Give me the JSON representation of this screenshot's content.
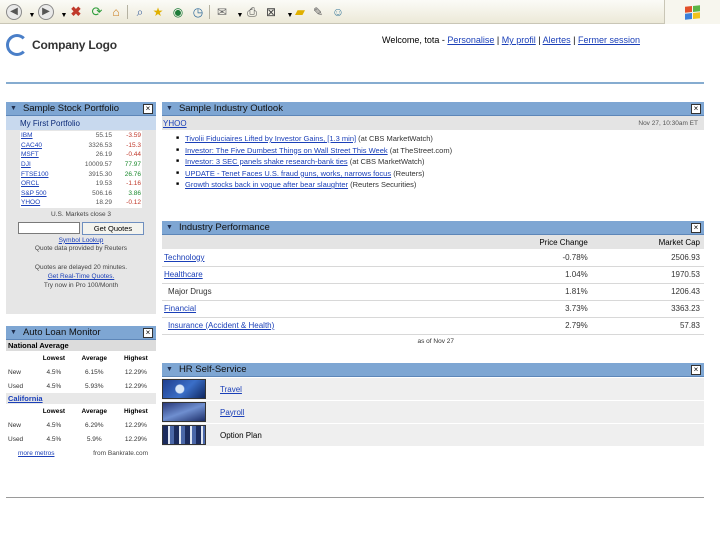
{
  "header": {
    "logo_text": "Company Logo",
    "welcome": "Welcome, tota -",
    "links": [
      "Personalise",
      "My profil",
      "Alertes",
      "Fermer session"
    ]
  },
  "stock_portfolio": {
    "title": "Sample Stock Portfolio",
    "subtitle": "My First Portfolio",
    "rows": [
      {
        "symbol": "IBM",
        "price": "55.15",
        "change": "-3.59",
        "dir": "neg"
      },
      {
        "symbol": "CAC40",
        "price": "3326.53",
        "change": "-15.3",
        "dir": "neg"
      },
      {
        "symbol": "MSFT",
        "price": "26.19",
        "change": "-0.44",
        "dir": "neg"
      },
      {
        "symbol": "DJI",
        "price": "10009.57",
        "change": "77.97",
        "dir": "pos"
      },
      {
        "symbol": "FTSE100",
        "price": "3915.30",
        "change": "26.76",
        "dir": "pos"
      },
      {
        "symbol": "ORCL",
        "price": "19.53",
        "change": "-1.16",
        "dir": "neg"
      },
      {
        "symbol": "S&P 500",
        "price": "506.16",
        "change": "3.86",
        "dir": "pos"
      },
      {
        "symbol": "YHOO",
        "price": "18.29",
        "change": "-0.12",
        "dir": "neg"
      }
    ],
    "market_note": "U.S. Markets close 3",
    "quote_button": "Get Quotes",
    "symbol_lookup": "Symbol Lookup",
    "quote_provider": "Quote data provided by Reuters",
    "delay_note": "Quotes are delayed 20 minutes.",
    "realtime_link": "Get Real-Time Quotes.",
    "pro_note": "Try now in Pro 100/Month"
  },
  "auto_loan": {
    "title": "Auto Loan Monitor",
    "columns": [
      "",
      "Lowest",
      "Average",
      "Highest"
    ],
    "regions": [
      {
        "name": "National Average",
        "rows": [
          [
            "New",
            "4.5%",
            "6.15%",
            "12.29%"
          ],
          [
            "Used",
            "4.5%",
            "5.93%",
            "12.29%"
          ]
        ]
      },
      {
        "name": "California",
        "rows": [
          [
            "New",
            "4.5%",
            "6.29%",
            "12.29%"
          ],
          [
            "Used",
            "4.5%",
            "5.9%",
            "12.29%"
          ]
        ]
      }
    ],
    "more_link": "more metros",
    "source": "from Bankrate.com"
  },
  "industry_outlook": {
    "title": "Sample Industry Outlook",
    "source": "YHOO",
    "date": "Nov 27, 10:30am ET",
    "news": [
      {
        "headline": "Tivolii Fiduciaires Lifted by Investor Gains, [1.3 min]",
        "source": "(at CBS MarketWatch)"
      },
      {
        "headline": "Investor: The Five Dumbest Things on Wall Street This Week",
        "source": "(at TheStreet.com)"
      },
      {
        "headline": "Investor: 3 SEC panels shake research-bank ties",
        "source": "(at CBS MarketWatch)"
      },
      {
        "headline": "UPDATE - Tenet Faces U.S. fraud guns, works, narrows focus",
        "source": "(Reuters)"
      },
      {
        "headline": "Growth stocks back in vogue after bear slaughter",
        "source": "(Reuters Securities)"
      }
    ]
  },
  "industry_performance": {
    "title": "Industry Performance",
    "columns": [
      "Price Change",
      "Market Cap"
    ],
    "rows": [
      {
        "name": "Technology",
        "kind": "link",
        "price_change": "-0.78%",
        "market_cap": "2506.93"
      },
      {
        "name": "Healthcare",
        "kind": "link",
        "price_change": "1.04%",
        "market_cap": "1970.53"
      },
      {
        "name": "Major Drugs",
        "kind": "sub",
        "price_change": "1.81%",
        "market_cap": "1206.43"
      },
      {
        "name": "Financial",
        "kind": "link",
        "price_change": "3.73%",
        "market_cap": "3363.23"
      },
      {
        "name": "Insurance (Accident & Health)",
        "kind": "ins",
        "price_change": "2.79%",
        "market_cap": "57.83"
      }
    ],
    "as_of": "as of Nov 27"
  },
  "hr_self_service": {
    "title": "HR Self-Service",
    "items": [
      {
        "label": "Travel",
        "link": true
      },
      {
        "label": "Payroll",
        "link": true
      },
      {
        "label": "Option Plan",
        "link": false
      }
    ]
  }
}
